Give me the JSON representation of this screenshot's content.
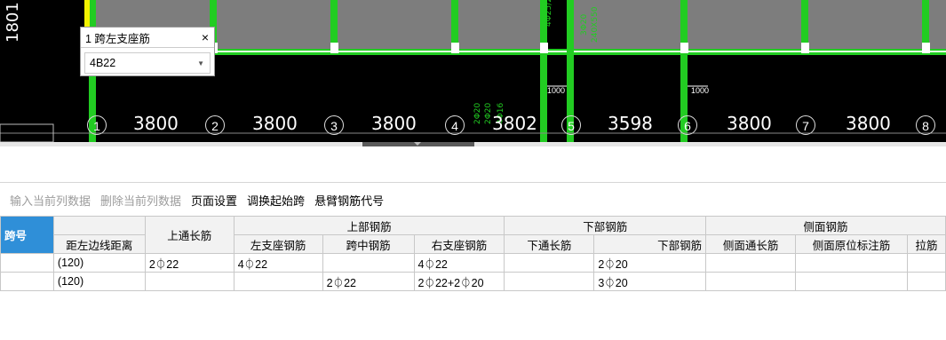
{
  "cad": {
    "left_label": "1801",
    "axis_dims": [
      "3800",
      "3800",
      "3800",
      "3802",
      "3598",
      "3800",
      "3800"
    ],
    "axis_numbers": [
      "1",
      "2",
      "3",
      "4",
      "5",
      "6",
      "7",
      "8"
    ],
    "small_dims": [
      "1000",
      "1000"
    ]
  },
  "popup": {
    "title": "1 跨左支座筋",
    "close": "×",
    "value": "4B22",
    "dropdown": "▼"
  },
  "toolbar": {
    "insert": "输入当前列数据",
    "delete": "删除当前列数据",
    "page_setup": "页面设置",
    "swap_span": "调换起始跨",
    "cantilever": "悬臂钢筋代号"
  },
  "table": {
    "h_span": "跨号",
    "h_dist": "距左边线距离",
    "h_top_long": "上通长筋",
    "h_top": "上部钢筋",
    "h_left_seat": "左支座钢筋",
    "h_mid": "跨中钢筋",
    "h_right_seat": "右支座钢筋",
    "h_bottom": "下部钢筋",
    "h_bot_long": "下通长筋",
    "h_bot_bar": "下部钢筋",
    "h_side": "侧面钢筋",
    "h_side_long": "侧面通长筋",
    "h_side_orig": "侧面原位标注筋",
    "h_tie": "拉筋",
    "rows": [
      {
        "span": "",
        "dist": "(120)",
        "top_long": "2⏀22",
        "left_seat": "4⏀22",
        "mid": "",
        "right_seat": "4⏀22",
        "bot_long": "",
        "bot_bar": "2⏀20",
        "side_long": "",
        "side_orig": "",
        "tie": ""
      },
      {
        "span": "",
        "dist": "(120)",
        "top_long": "",
        "left_seat": "",
        "mid": "2⏀22",
        "right_seat": "2⏀22+2⏀20",
        "bot_long": "",
        "bot_bar": "3⏀20",
        "side_long": "",
        "side_orig": "",
        "tie": ""
      }
    ]
  }
}
